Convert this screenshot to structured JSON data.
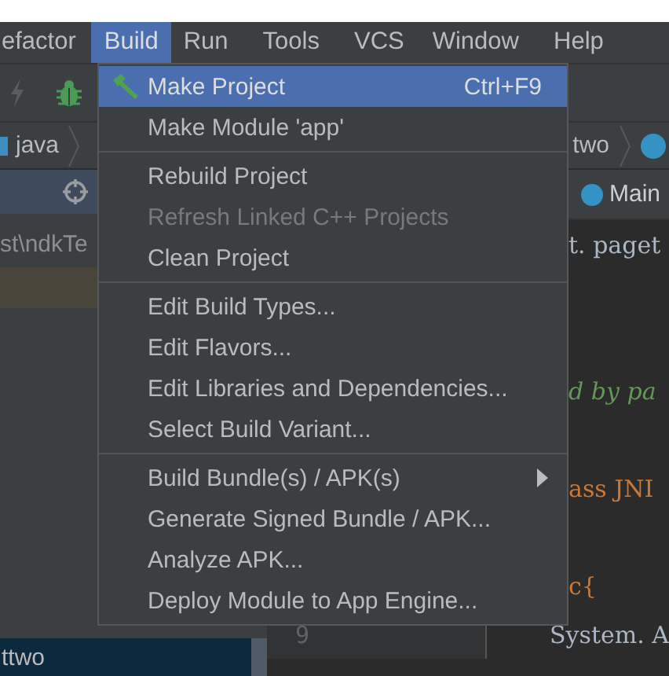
{
  "menubar": [
    {
      "label": "efactor",
      "selected": false
    },
    {
      "label": "Build",
      "selected": true
    },
    {
      "label": "Run",
      "selected": false
    },
    {
      "label": "Tools",
      "selected": false
    },
    {
      "label": "VCS",
      "selected": false
    },
    {
      "label": "Window",
      "selected": false
    },
    {
      "label": "Help",
      "selected": false
    }
  ],
  "breadcrumbs": [
    {
      "label": "java",
      "kind": "folder"
    },
    {
      "label": "two",
      "kind": "class"
    }
  ],
  "project_panel": {
    "path": "st\\ndkTe",
    "selected_item": "ttwo"
  },
  "editor": {
    "tab": "Main",
    "lines": [
      {
        "text": "t. paget",
        "kind": "plain"
      },
      {
        "kind": "blank"
      },
      {
        "kind": "blank"
      },
      {
        "text": "d by pa",
        "kind": "comment"
      },
      {
        "kind": "blank"
      },
      {
        "text": "ass JNI",
        "kind": "keyword"
      },
      {
        "kind": "blank"
      },
      {
        "text": "c{",
        "kind": "keyword"
      },
      {
        "number": "9",
        "text": "System. A",
        "kind": "indented"
      }
    ]
  },
  "menu": {
    "groups": [
      [
        {
          "label": "Make Project",
          "shortcut": "Ctrl+F9",
          "icon": true,
          "selected": true,
          "disabled": false,
          "submenu": false
        },
        {
          "label": "Make Module 'app'",
          "icon": false,
          "selected": false,
          "disabled": false,
          "submenu": false
        }
      ],
      [
        {
          "label": "Rebuild Project",
          "icon": false,
          "selected": false,
          "disabled": false,
          "submenu": false
        },
        {
          "label": "Refresh Linked C++ Projects",
          "icon": false,
          "selected": false,
          "disabled": true,
          "submenu": false
        },
        {
          "label": "Clean Project",
          "icon": false,
          "selected": false,
          "disabled": false,
          "submenu": false
        }
      ],
      [
        {
          "label": "Edit Build Types...",
          "icon": false,
          "selected": false,
          "disabled": false,
          "submenu": false
        },
        {
          "label": "Edit Flavors...",
          "icon": false,
          "selected": false,
          "disabled": false,
          "submenu": false
        },
        {
          "label": "Edit Libraries and Dependencies...",
          "icon": false,
          "selected": false,
          "disabled": false,
          "submenu": false
        },
        {
          "label": "Select Build Variant...",
          "icon": false,
          "selected": false,
          "disabled": false,
          "submenu": false
        }
      ],
      [
        {
          "label": "Build Bundle(s) / APK(s)",
          "icon": false,
          "selected": false,
          "disabled": false,
          "submenu": true
        },
        {
          "label": "Generate Signed Bundle / APK...",
          "icon": false,
          "selected": false,
          "disabled": false,
          "submenu": false
        },
        {
          "label": "Analyze APK...",
          "icon": false,
          "selected": false,
          "disabled": false,
          "submenu": false
        },
        {
          "label": "Deploy Module to App Engine...",
          "icon": false,
          "selected": false,
          "disabled": false,
          "submenu": false
        }
      ]
    ]
  }
}
